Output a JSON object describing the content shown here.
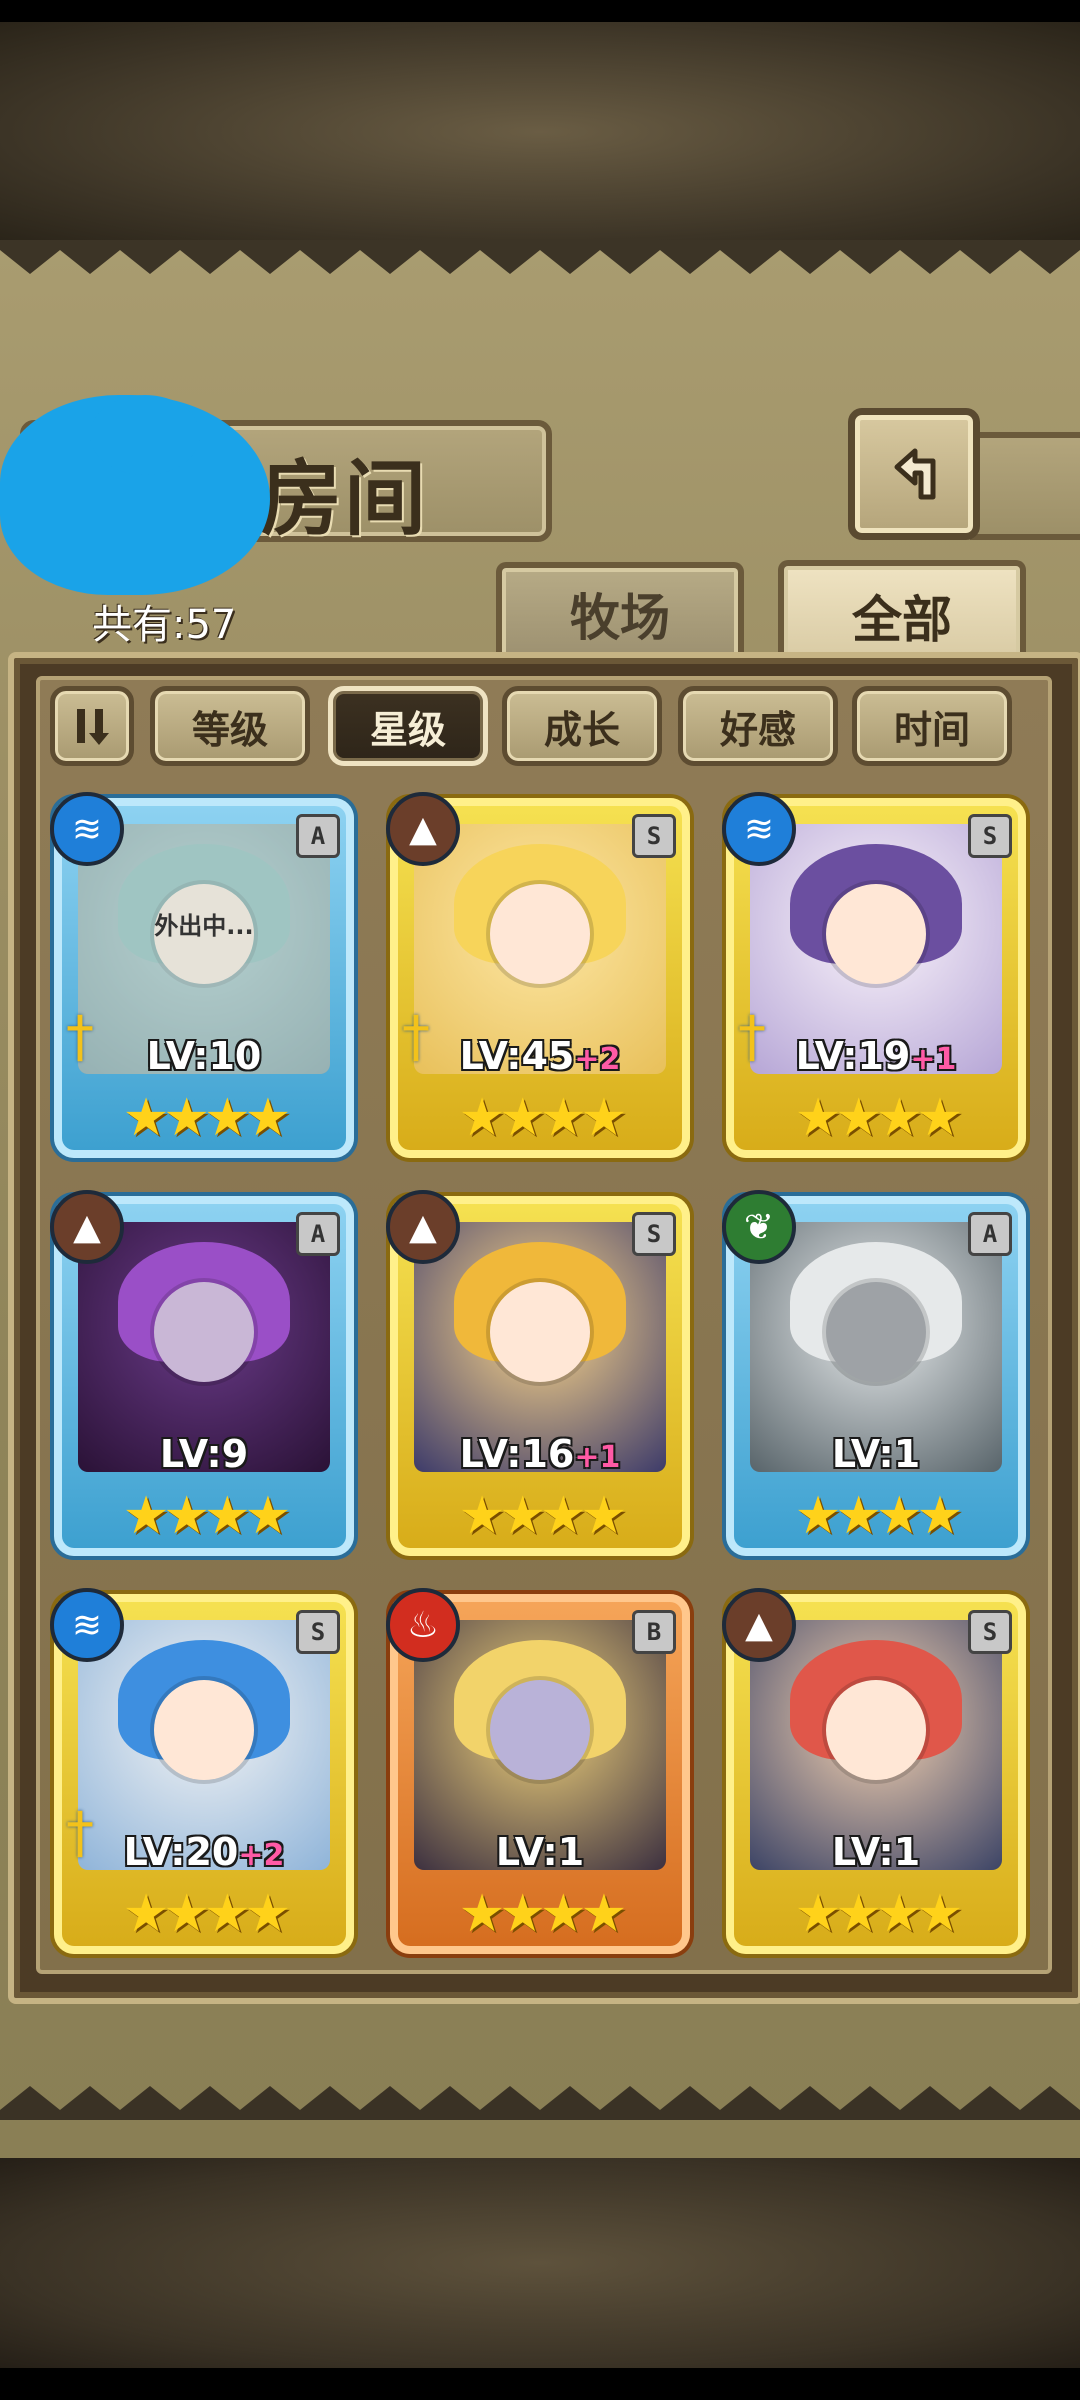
{
  "header": {
    "title": "物房间",
    "count_label": "共有:57"
  },
  "tabs": [
    {
      "label": "牧场",
      "active": false
    },
    {
      "label": "全部",
      "active": true
    }
  ],
  "sort": {
    "order_icon": "sort-order-icon",
    "buttons": [
      {
        "label": "等级",
        "active": false
      },
      {
        "label": "星级",
        "active": true
      },
      {
        "label": "成长",
        "active": false
      },
      {
        "label": "好感",
        "active": false
      },
      {
        "label": "时间",
        "active": false
      }
    ]
  },
  "cards": [
    {
      "level": "LV:10",
      "bonus": "",
      "rank": "A",
      "element": "water",
      "frame": "blue",
      "stars": "★★★★",
      "status": "外出中...",
      "equipped": true
    },
    {
      "level": "LV:45",
      "bonus": "+2",
      "rank": "S",
      "element": "earth",
      "frame": "gold",
      "stars": "★★★★",
      "status": "",
      "equipped": true
    },
    {
      "level": "LV:19",
      "bonus": "+1",
      "rank": "S",
      "element": "water",
      "frame": "gold",
      "stars": "★★★★",
      "status": "",
      "equipped": true
    },
    {
      "level": "LV:9",
      "bonus": "",
      "rank": "A",
      "element": "earth",
      "frame": "blue",
      "stars": "★★★★",
      "status": "",
      "equipped": false
    },
    {
      "level": "LV:16",
      "bonus": "+1",
      "rank": "S",
      "element": "earth",
      "frame": "gold",
      "stars": "★★★★",
      "status": "",
      "equipped": false
    },
    {
      "level": "LV:1",
      "bonus": "",
      "rank": "A",
      "element": "wood",
      "frame": "blue",
      "stars": "★★★★",
      "status": "",
      "equipped": false
    },
    {
      "level": "LV:20",
      "bonus": "+2",
      "rank": "S",
      "element": "water",
      "frame": "gold",
      "stars": "★★★★",
      "status": "",
      "equipped": true
    },
    {
      "level": "LV:1",
      "bonus": "",
      "rank": "B",
      "element": "fire",
      "frame": "orange",
      "stars": "★★★★",
      "status": "",
      "equipped": false
    },
    {
      "level": "LV:1",
      "bonus": "",
      "rank": "S",
      "element": "earth",
      "frame": "gold",
      "stars": "★★★★",
      "status": "",
      "equipped": false
    }
  ],
  "colors": {
    "water": "#1f7fd9",
    "earth": "#6b3e2a",
    "wood": "#2e7d32",
    "fire": "#d22d1f"
  }
}
